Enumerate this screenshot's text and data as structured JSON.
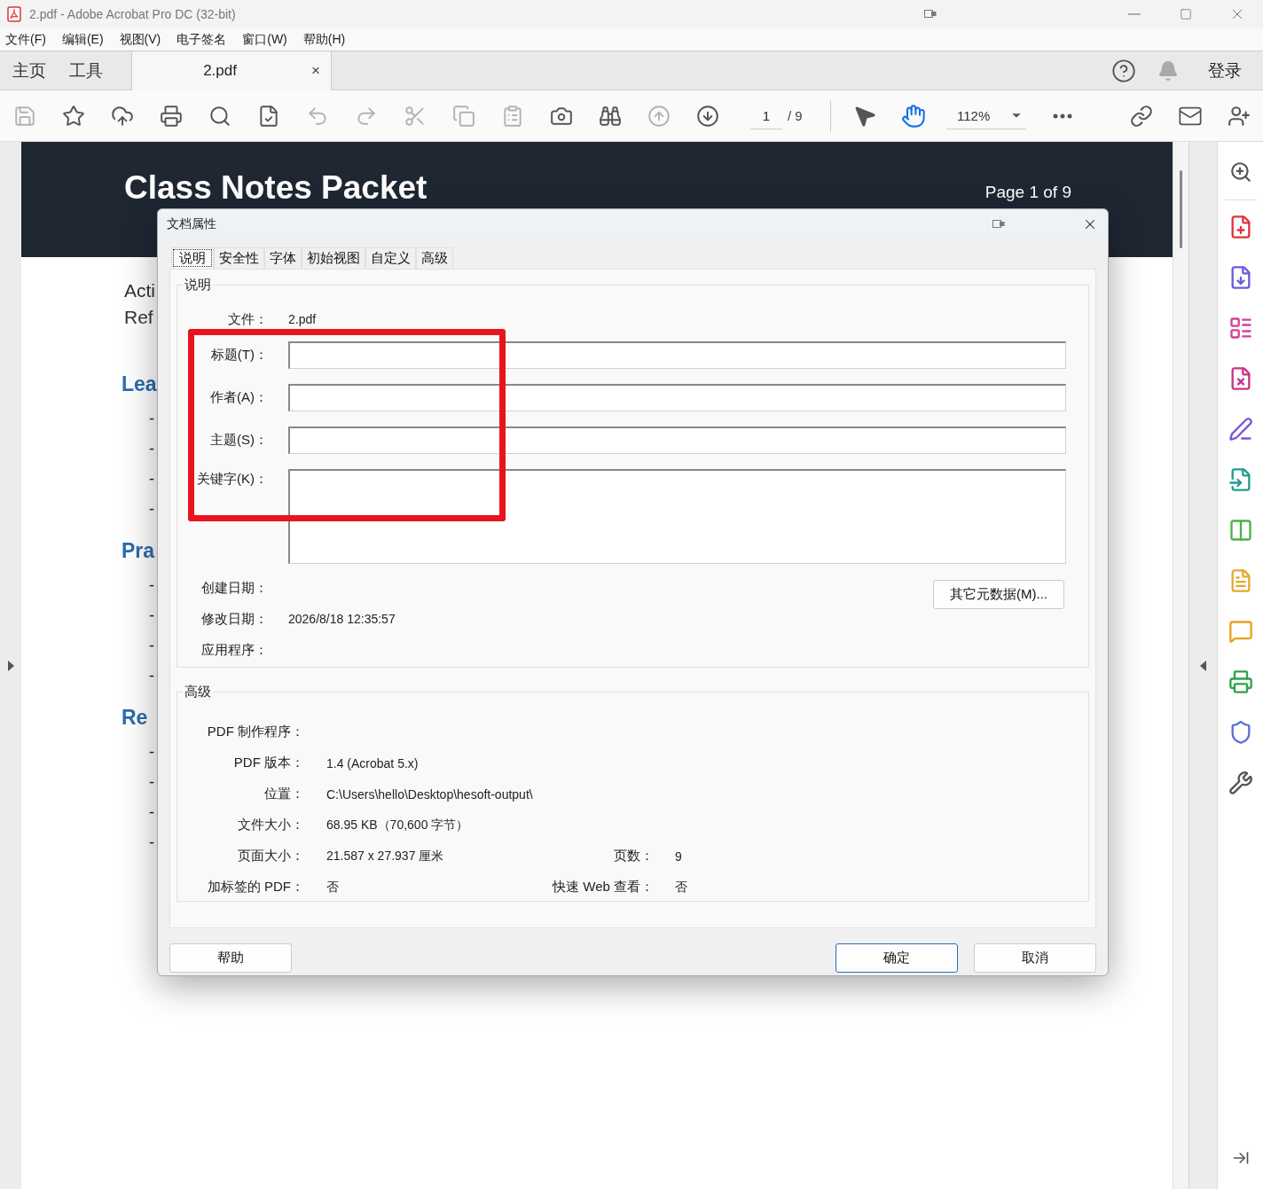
{
  "window": {
    "title": "2.pdf - Adobe Acrobat Pro DC (32-bit)"
  },
  "menu": [
    "文件(F)",
    "编辑(E)",
    "视图(V)",
    "电子签名",
    "窗口(W)",
    "帮助(H)"
  ],
  "nav_tabs": [
    {
      "label": "主页",
      "selected": false
    },
    {
      "label": "工具",
      "selected": false
    }
  ],
  "document_tab": {
    "label": "2.pdf",
    "close": "×",
    "selected": true
  },
  "sign_in": "登录",
  "toolbar": {
    "buttons": [
      {
        "disabled": true
      },
      {
        "disabled": false
      },
      {
        "disabled": false
      },
      {
        "disabled": false
      },
      {
        "disabled": false
      },
      {
        "disabled": false
      },
      {
        "disabled": true
      },
      {
        "disabled": true
      },
      {
        "disabled": true
      },
      {
        "disabled": true
      },
      {
        "disabled": true
      },
      {
        "disabled": false
      },
      {
        "disabled": false
      },
      {
        "disabled": true
      },
      {
        "disabled": false
      }
    ],
    "page": {
      "value": "1",
      "total": "/ 9"
    },
    "tools": [
      {
        "selected": false
      },
      {
        "selected": true
      }
    ],
    "zoom": "112%"
  },
  "document": {
    "title": "Class Notes Packet",
    "page_label": "Page 1 of 9",
    "lines": [
      {
        "kind": "text",
        "text": "Acti"
      },
      {
        "kind": "text",
        "text": "Ref"
      },
      {
        "kind": "heading",
        "text": "Lea"
      },
      {
        "kind": "bullet",
        "text": "-"
      },
      {
        "kind": "bullet",
        "text": "-"
      },
      {
        "kind": "bullet",
        "text": "-"
      },
      {
        "kind": "bullet",
        "text": "-"
      },
      {
        "kind": "heading",
        "text": "Pra"
      },
      {
        "kind": "bullet",
        "text": "-"
      },
      {
        "kind": "bullet",
        "text": "-"
      },
      {
        "kind": "bullet",
        "text": "-"
      },
      {
        "kind": "bullet",
        "text": "-"
      },
      {
        "kind": "heading",
        "text": "Re"
      },
      {
        "kind": "bullet",
        "text": "-"
      },
      {
        "kind": "bullet",
        "text": "-"
      },
      {
        "kind": "bullet",
        "text": "-"
      },
      {
        "kind": "bullet",
        "text": "-"
      }
    ]
  },
  "dialog": {
    "title": "文档属性",
    "tabs": [
      {
        "label": "说明",
        "selected": true
      },
      {
        "label": "安全性",
        "selected": false
      },
      {
        "label": "字体",
        "selected": false
      },
      {
        "label": "初始视图",
        "selected": false
      },
      {
        "label": "自定义",
        "selected": false
      },
      {
        "label": "高级",
        "selected": false
      }
    ],
    "description": {
      "legend": "说明",
      "file": {
        "label": "文件：",
        "value": "2.pdf"
      },
      "fields": [
        {
          "label": "标题(T)：",
          "kind": "line"
        },
        {
          "label": "作者(A)：",
          "kind": "line"
        },
        {
          "label": "主题(S)：",
          "kind": "line"
        },
        {
          "label": "关键字(K)：",
          "kind": "area"
        }
      ],
      "dates": [
        {
          "label": "创建日期："
        },
        {
          "label": "修改日期：",
          "value": "2026/8/18 12:35:57"
        },
        {
          "label": "应用程序："
        }
      ],
      "metadata_button": "其它元数据(M)..."
    },
    "advanced": {
      "legend": "高级",
      "rows": [
        {
          "label": "PDF 制作程序："
        },
        {
          "label": "PDF 版本：",
          "value": "1.4 (Acrobat 5.x)"
        },
        {
          "label": "位置：",
          "value": "C:\\Users\\hello\\Desktop\\hesoft-output\\"
        },
        {
          "label": "文件大小：",
          "value": "68.95 KB（70,600 字节）"
        },
        {
          "label": "页面大小：",
          "value": "21.587 x 27.937 厘米",
          "extra_label": "页数：",
          "extra_value": "9"
        },
        {
          "label": "加标签的 PDF：",
          "value": "否",
          "extra_label": "快速 Web 查看：",
          "extra_value": "否"
        }
      ]
    },
    "buttons": [
      {
        "label": "帮助",
        "default": false
      },
      {
        "label": "确定",
        "default": true
      },
      {
        "label": "取消",
        "default": false
      }
    ]
  }
}
